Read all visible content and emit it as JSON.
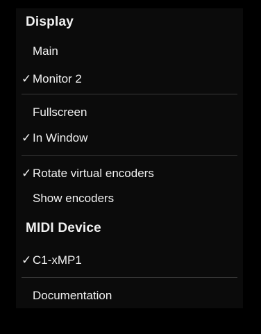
{
  "menu": {
    "check_glyph": "✓",
    "sections": {
      "display_header": "Display",
      "midi_header": "MIDI Device"
    },
    "items": {
      "main": {
        "label": "Main",
        "checked": false
      },
      "monitor2": {
        "label": "Monitor 2",
        "checked": true
      },
      "fullscreen": {
        "label": "Fullscreen",
        "checked": false
      },
      "in_window": {
        "label": "In Window",
        "checked": true
      },
      "rotate_encoders": {
        "label": "Rotate virtual encoders",
        "checked": true
      },
      "show_encoders": {
        "label": "Show encoders",
        "checked": false
      },
      "c1_xmp1": {
        "label": "C1-xMP1",
        "checked": true
      },
      "documentation": {
        "label": "Documentation",
        "checked": false
      }
    }
  },
  "colors": {
    "background": "#000000",
    "menu_background": "#0b0b0b",
    "text": "#f2f2f2",
    "separator": "#3a3a3a"
  }
}
